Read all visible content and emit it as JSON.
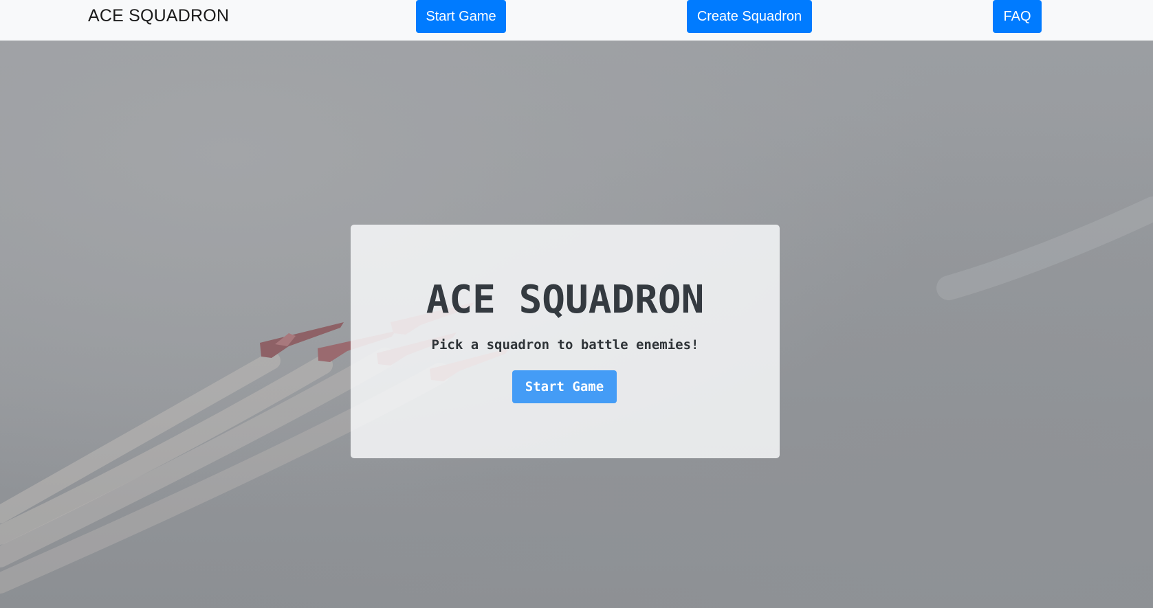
{
  "navbar": {
    "brand": "ACE SQUADRON",
    "start_game_label": "Start Game",
    "create_squadron_label": "Create Squadron",
    "faq_label": "FAQ"
  },
  "hero": {
    "title": "ACE SQUADRON",
    "subtitle": "Pick a squadron to battle enemies!",
    "start_game_label": "Start Game",
    "image": "red-jets-formation-background"
  },
  "colors": {
    "navbar_bg": "#f8f9fa",
    "primary_button": "#007bff",
    "card_button": "#449cf6",
    "title_text": "#343a40"
  }
}
